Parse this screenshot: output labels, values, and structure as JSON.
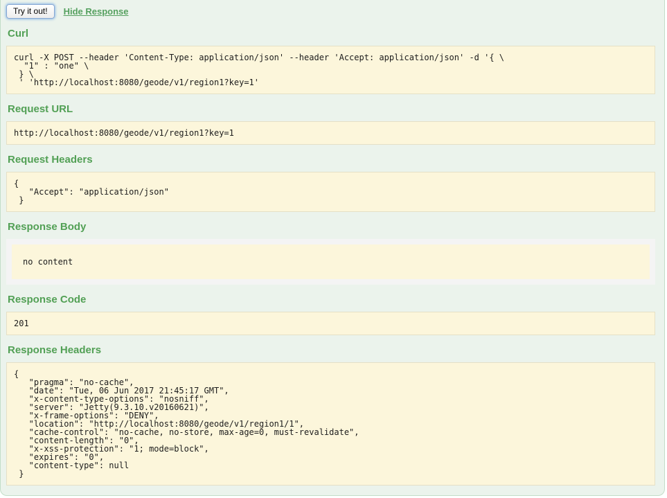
{
  "toolbar": {
    "try_it_out_label": "Try it out!",
    "hide_response_label": "Hide Response"
  },
  "sections": {
    "curl": {
      "heading": "Curl",
      "code": "curl -X POST --header 'Content-Type: application/json' --header 'Accept: application/json' -d '{ \\\n  \"1\" : \"one\" \\\n } \\\n ' 'http://localhost:8080/geode/v1/region1?key=1'"
    },
    "request_url": {
      "heading": "Request URL",
      "code": "http://localhost:8080/geode/v1/region1?key=1"
    },
    "request_headers": {
      "heading": "Request Headers",
      "code": "{\n   \"Accept\": \"application/json\"\n }"
    },
    "response_body": {
      "heading": "Response Body",
      "code": "no content"
    },
    "response_code": {
      "heading": "Response Code",
      "code": "201"
    },
    "response_headers": {
      "heading": "Response Headers",
      "code": "{\n   \"pragma\": \"no-cache\",\n   \"date\": \"Tue, 06 Jun 2017 21:45:17 GMT\",\n   \"x-content-type-options\": \"nosniff\",\n   \"server\": \"Jetty(9.3.10.v20160621)\",\n   \"x-frame-options\": \"DENY\",\n   \"location\": \"http://localhost:8080/geode/v1/region1/1\",\n   \"cache-control\": \"no-cache, no-store, max-age=0, must-revalidate\",\n   \"content-length\": \"0\",\n   \"x-xss-protection\": \"1; mode=block\",\n   \"expires\": \"0\",\n   \"content-type\": null\n }"
    }
  },
  "colors": {
    "panel_background": "#ebf3ec",
    "panel_border": "#c2ddc7",
    "heading_green": "#52a055",
    "code_background": "#fcf6db",
    "code_border": "#e5e0c6",
    "response_body_wrap_background": "#f4f4f4"
  }
}
